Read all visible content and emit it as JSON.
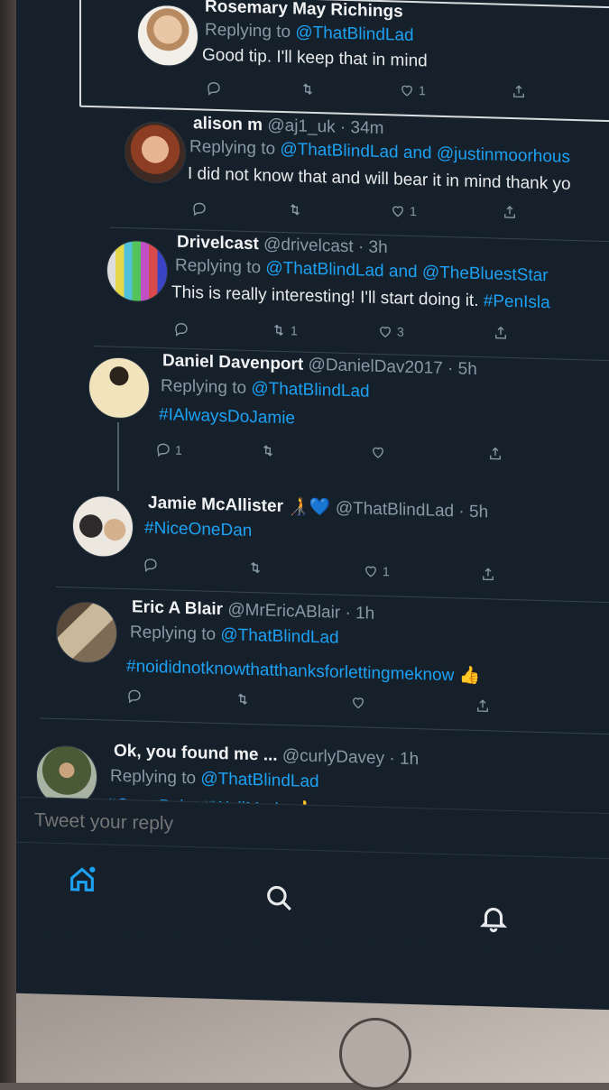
{
  "tweets": [
    {
      "name": "Rosemary May Richings",
      "handle": "",
      "time": "",
      "replying_prefix": "Replying to",
      "replying_to": "@ThatBlindLad",
      "text": "Good tip. I'll keep that in mind",
      "replies": "",
      "retweets": "",
      "likes": "1"
    },
    {
      "name": "alison m",
      "handle": "@aj1_uk",
      "time": "· 34m",
      "replying_prefix": "Replying to",
      "replying_to": "@ThatBlindLad and @justinmoorhous",
      "text": "I did not know that and will bear it in mind thank yo",
      "replies": "",
      "retweets": "",
      "likes": "1"
    },
    {
      "name": "Drivelcast",
      "handle": "@drivelcast",
      "time": "· 3h",
      "replying_prefix": "Replying to",
      "replying_to": "@ThatBlindLad and @TheBluestStar",
      "text": "This is really interesting! I'll start doing it.",
      "text_tag": "#PenIsla",
      "replies": "",
      "retweets": "1",
      "likes": "3"
    },
    {
      "name": "Daniel Davenport",
      "handle": "@DanielDav2017",
      "time": "· 5h",
      "replying_prefix": "Replying to",
      "replying_to": "@ThatBlindLad",
      "text": "#IAlwaysDoJamie",
      "replies": "1",
      "retweets": "",
      "likes": ""
    },
    {
      "name": "Jamie McAllister 🧑‍🦯💙",
      "handle": "@ThatBlindLad",
      "time": "· 5h",
      "text": "#NiceOneDan",
      "replies": "",
      "retweets": "",
      "likes": "1"
    },
    {
      "name": "Eric A Blair",
      "handle": "@MrEricABlair",
      "time": "· 1h",
      "replying_prefix": "Replying to",
      "replying_to": "@ThatBlindLad",
      "text": "#noididnotknowthatthanksforlettingmeknow 👍",
      "replies": "",
      "retweets": "",
      "likes": ""
    },
    {
      "name": "Ok, you found me ...",
      "handle": "@curlyDavey",
      "time": "· 1h",
      "replying_prefix": "Replying to",
      "replying_to": "@ThatBlindLad",
      "text": "#GreatPoint #WellMade 👍"
    }
  ],
  "reply_bar": {
    "placeholder": "Tweet your reply"
  },
  "tabs": [
    "home-icon",
    "search-icon",
    "notifications-icon"
  ],
  "colors": {
    "background": "#15202b",
    "accent": "#1da1f2",
    "muted": "#8899a6",
    "text": "#e7e9ea"
  }
}
